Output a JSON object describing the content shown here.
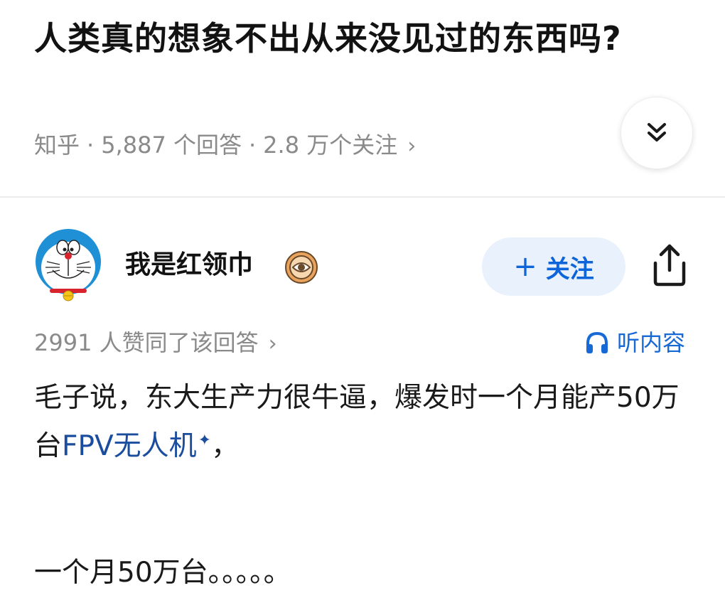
{
  "question": {
    "title": "人类真的想象不出从来没见过的东西吗?",
    "source": "知乎",
    "answer_count": "5,887 个回答",
    "follower_count": "2.8 万个关注",
    "meta_chevron": "›"
  },
  "icons": {
    "expand": "double-chevron-down-icon",
    "share": "share-icon",
    "listen": "headphones-icon",
    "badge": "eye-badge-icon"
  },
  "author": {
    "name": "我是红领巾",
    "follow_label": "关注",
    "follow_plus": "+"
  },
  "answer": {
    "vote_text": "2991 人赞同了该回答",
    "vote_chevron": "›",
    "listen_label": "听内容",
    "para1_before": "毛子说，东大生产力很牛逼，爆发时一个月能产50万台",
    "para1_link": "FPV无人机",
    "para1_star": "✦",
    "para1_after": "，",
    "para2": "一个月50万台。。。。。"
  },
  "colors": {
    "accent": "#0d65d9",
    "follow_bg": "#e9f1fd",
    "link": "#1a4d9e",
    "muted": "#8a8a8a"
  }
}
